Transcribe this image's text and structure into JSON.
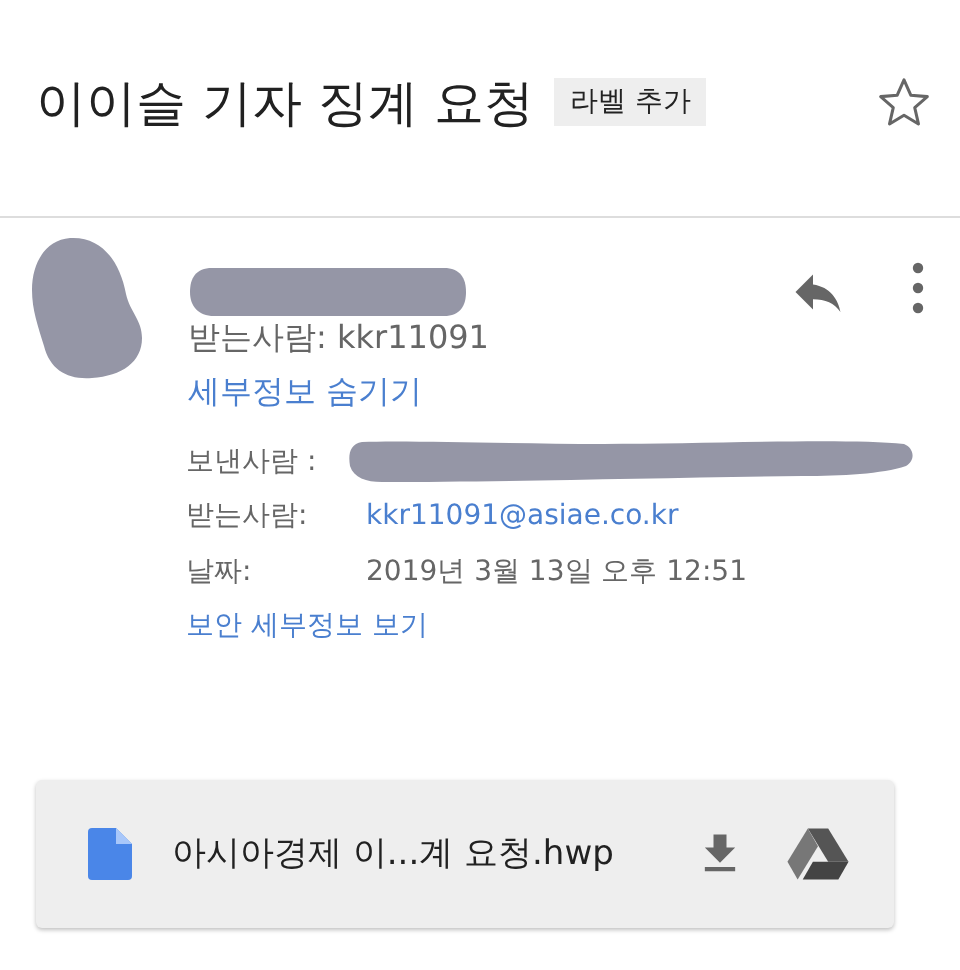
{
  "subject": {
    "title": "이이슬 기자 징계 요청",
    "label_chip": "라벨 추가",
    "starred": false
  },
  "message": {
    "recipient_summary": "받는사람: kkr11091",
    "details_toggle": "세부정보 숨기기",
    "details": [
      {
        "label": "보낸사람 :",
        "kind": "redacted"
      },
      {
        "label": "받는사람:",
        "value": "kkr11091@asiae.co.kr",
        "kind": "link"
      },
      {
        "label": "날짜:",
        "value": "2019년 3월 13일 오후 12:51",
        "kind": "text"
      }
    ],
    "security_link": "보안 세부정보 보기"
  },
  "attachment": {
    "filename": "아시아경제 이...계 요청.hwp"
  }
}
